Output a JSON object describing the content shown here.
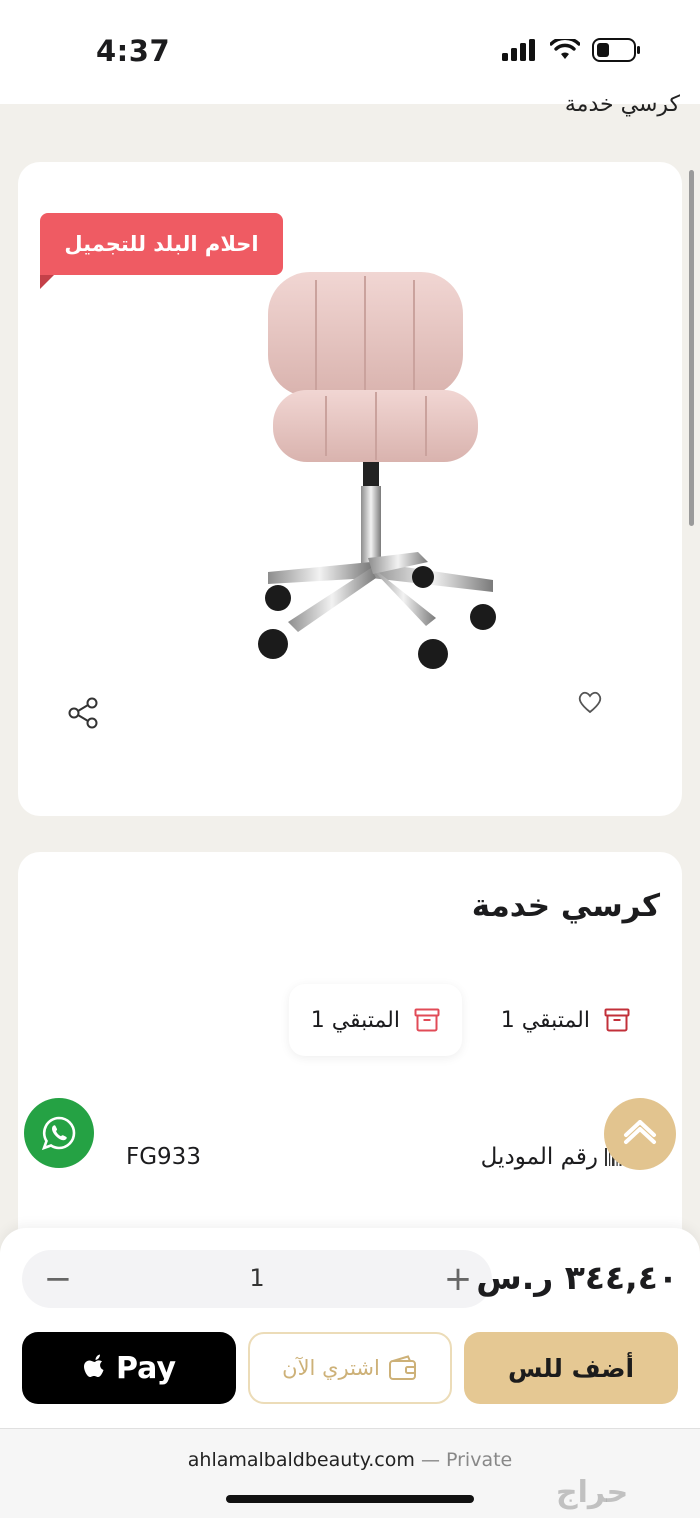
{
  "status_bar": {
    "time": "4:37"
  },
  "breadcrumb": "كرسي خدمة",
  "product": {
    "brand_badge": "احلام البلد للتجميل",
    "title": "كرسي خدمة",
    "stock": [
      {
        "label": "المتبقي 1"
      },
      {
        "label": "المتبقي 1"
      }
    ],
    "model_label": "رقم الموديل",
    "model_value": "FG933"
  },
  "cart": {
    "quantity": "1",
    "price": "٣٤٤,٤٠ ر.س",
    "apple_pay_label": "Pay",
    "buy_now_label": "اشتري الآن",
    "add_to_cart_label": "أضف للس"
  },
  "browser": {
    "domain": "ahlamalbaldbeauty.com",
    "separator": "—",
    "private_label": "Private"
  },
  "watermark": "حراج",
  "colors": {
    "badge": "#ef5b63",
    "accent_gold": "#e5c893",
    "whatsapp": "#25a244",
    "stock_icon": "#c2303a"
  },
  "icons": [
    "signal-icon",
    "wifi-icon",
    "battery-icon",
    "share-icon",
    "heart-icon",
    "archive-box-icon",
    "barcode-icon",
    "whatsapp-icon",
    "chevron-up-icon",
    "apple-logo-icon",
    "wallet-icon"
  ]
}
